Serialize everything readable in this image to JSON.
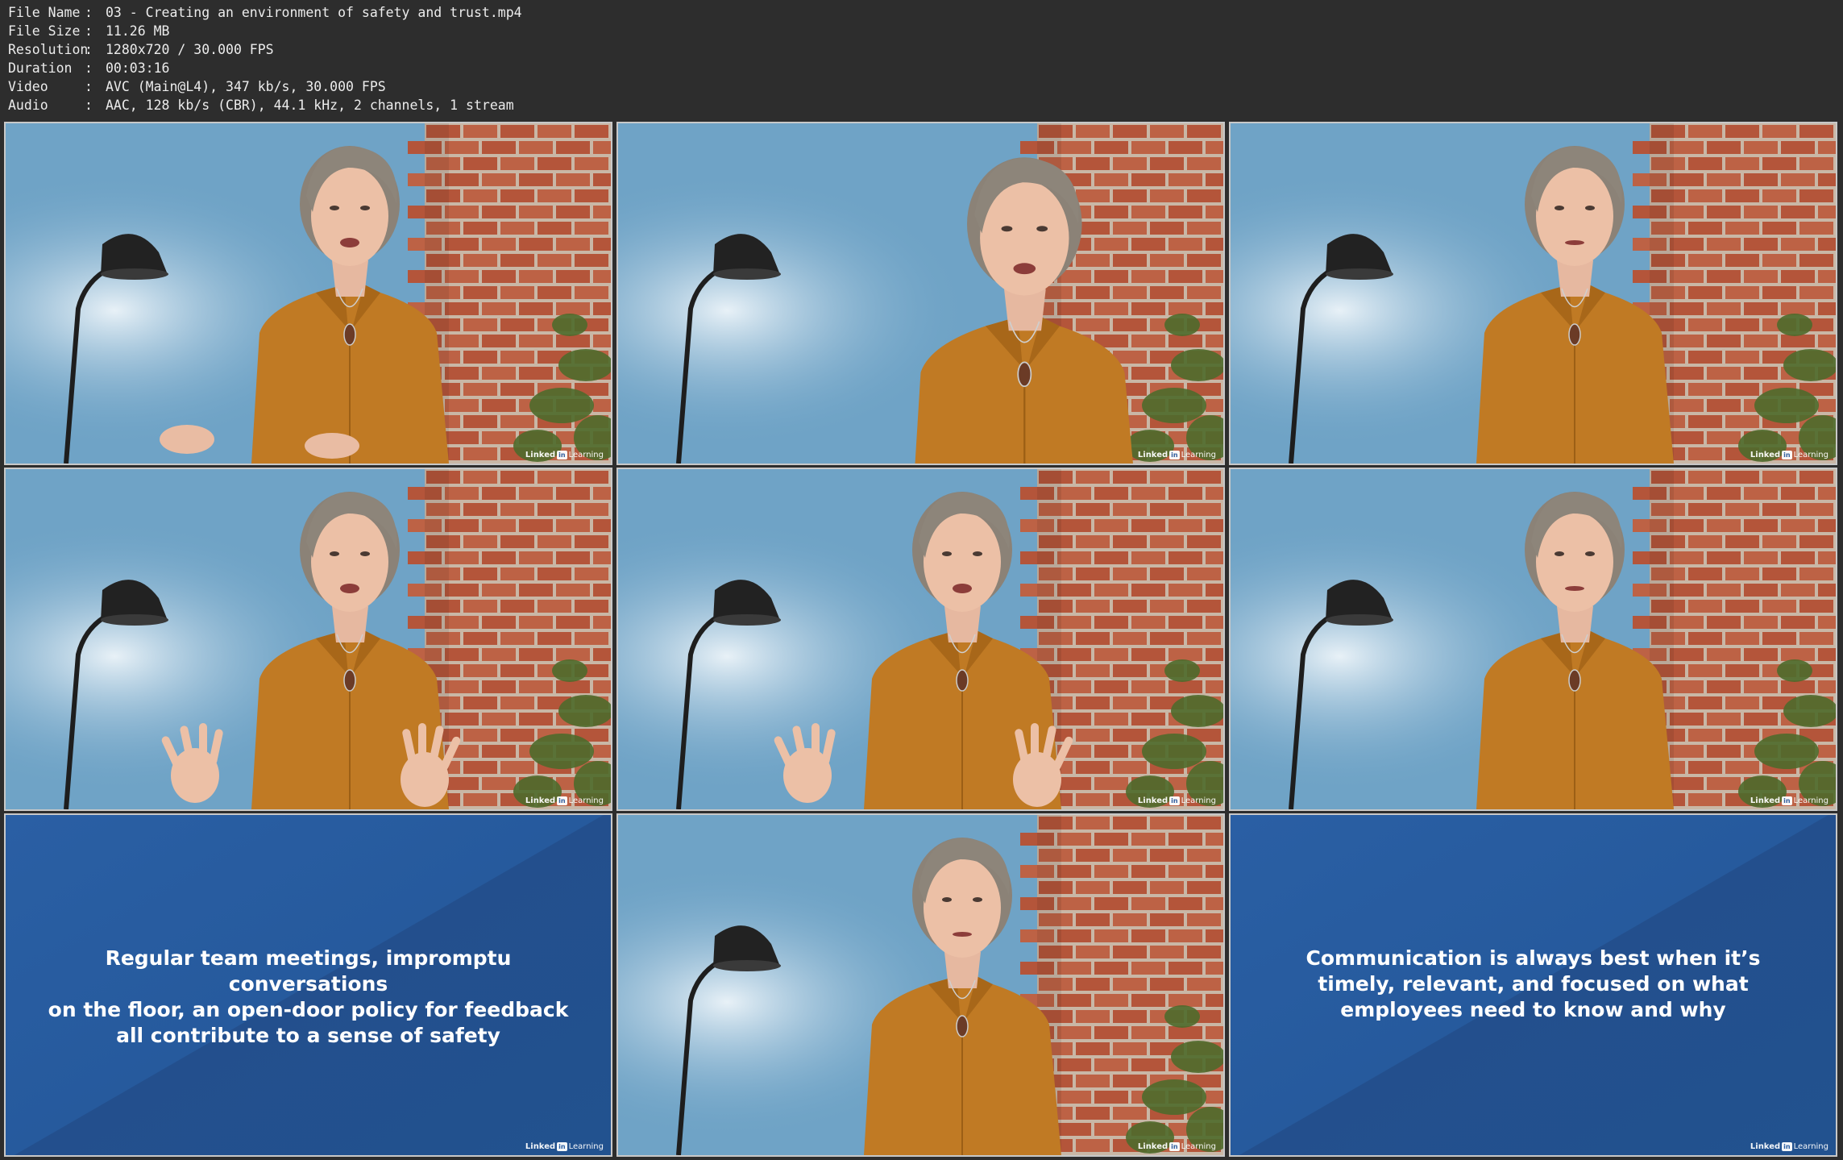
{
  "file_info": {
    "rows": [
      {
        "key": "File Name",
        "value": "03 - Creating an environment of safety and trust.mp4"
      },
      {
        "key": "File Size",
        "value": "11.26 MB"
      },
      {
        "key": "Resolution",
        "value": "1280x720 / 30.000 FPS"
      },
      {
        "key": "Duration",
        "value": "00:03:16"
      },
      {
        "key": "Video",
        "value": "AVC (Main@L4), 347 kb/s, 30.000 FPS"
      },
      {
        "key": "Audio",
        "value": "AAC, 128 kb/s (CBR), 44.1 kHz, 2 channels, 1 stream"
      }
    ],
    "colon": ":"
  },
  "watermark": {
    "brand": "Linked",
    "in": "in",
    "product": "Learning"
  },
  "thumbnails": [
    {
      "kind": "video",
      "pose": "hands-low"
    },
    {
      "kind": "video",
      "pose": "close"
    },
    {
      "kind": "video",
      "pose": "plain"
    },
    {
      "kind": "video",
      "pose": "hands-open"
    },
    {
      "kind": "video",
      "pose": "hands-open"
    },
    {
      "kind": "video",
      "pose": "plain"
    },
    {
      "kind": "slide",
      "lines": [
        "Regular team meetings, impromptu conversations",
        "on the floor, an open-door policy for feedback",
        "all contribute to a sense of safety"
      ]
    },
    {
      "kind": "video",
      "pose": "plain"
    },
    {
      "kind": "slide",
      "lines": [
        "Communication is always best when it’s",
        "timely, relevant, and focused on what",
        "employees need to know and why"
      ]
    }
  ],
  "colors": {
    "background": "#2d2d2d",
    "wall": "#6fa3c6",
    "brick": "#b4553a",
    "shirt": "#c07a24",
    "slide_blue": "#265a9d"
  }
}
